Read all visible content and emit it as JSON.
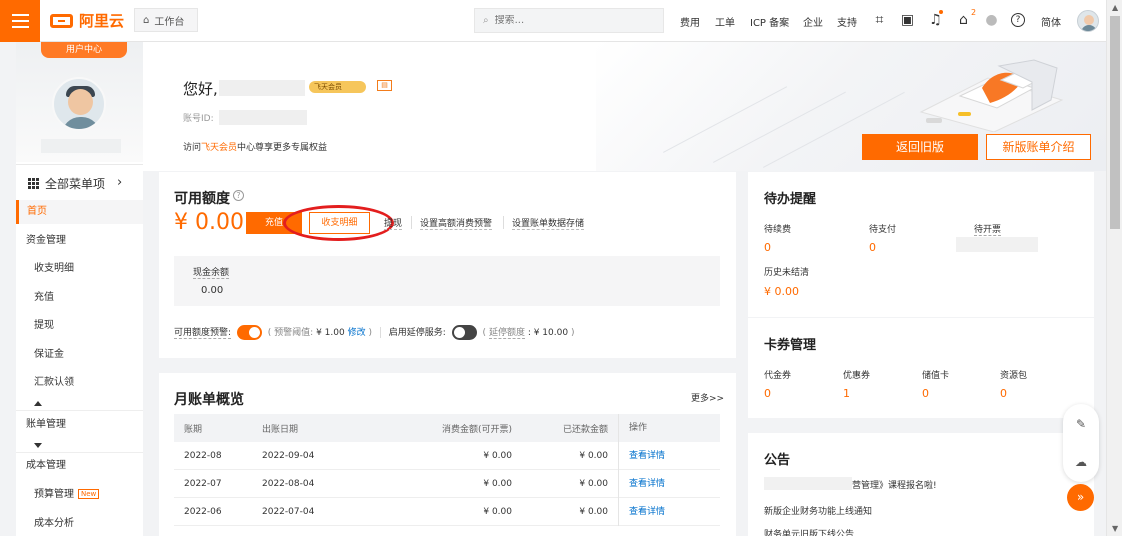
{
  "app": {
    "brand": "阿里云",
    "workbench": "工作台",
    "search_placeholder": "搜索...",
    "nav": [
      "费用",
      "工单",
      "ICP 备案",
      "企业",
      "支持",
      "简体"
    ],
    "notification_count": "2",
    "accent_color": "#ff6a00"
  },
  "sidebar": {
    "user_center": "用户中心",
    "all_menu": "全部菜单项",
    "items": [
      {
        "label": "首页"
      },
      {
        "label": "资金管理"
      },
      {
        "label": "收支明细"
      },
      {
        "label": "充值"
      },
      {
        "label": "提现"
      },
      {
        "label": "保证金"
      },
      {
        "label": "汇款认领"
      },
      {
        "label": "账单管理"
      },
      {
        "label": "成本管理"
      },
      {
        "label": "预算管理",
        "badge": "New"
      },
      {
        "label": "成本分析"
      }
    ]
  },
  "hero": {
    "greeting": "您好,",
    "vip": "飞天会员",
    "account_label": "账号ID:",
    "vip_prefix": "访问",
    "vip_link": "飞天会员",
    "vip_suffix": "中心尊享更多专属权益",
    "old_button": "返回旧版",
    "new_button": "新版账单介绍"
  },
  "credit": {
    "title": "可用额度",
    "help": "?",
    "amount": "¥ 0.00",
    "recharge": "充值",
    "details": "收支明细",
    "withdraw": "提现",
    "high_spend": "设置高额消费预警",
    "bill_storage": "设置账单数据存储",
    "cash_label": "现金余额",
    "cash_value": "0.00",
    "alert_label": "可用额度预警:",
    "alert_prefix": "( 预警阈值:",
    "alert_value": "¥ 1.00",
    "modify": "修改",
    "alert_suffix": ")",
    "service_label": "启用延停服务:",
    "service_prefix": "(",
    "service_quota_label": "延停额度",
    "service_value": ": ¥ 10.00",
    "service_suffix": ")"
  },
  "todo": {
    "title": "待办提醒",
    "renewal": {
      "label": "待续费",
      "value": "0"
    },
    "payment": {
      "label": "待支付",
      "value": "0"
    },
    "invoice": {
      "label": "待开票"
    },
    "history": {
      "label": "历史未结清",
      "value": "¥ 0.00"
    }
  },
  "cards": {
    "title": "卡券管理",
    "items": [
      {
        "label": "代金券",
        "value": "0"
      },
      {
        "label": "优惠券",
        "value": "1"
      },
      {
        "label": "储值卡",
        "value": "0"
      },
      {
        "label": "资源包",
        "value": "0"
      }
    ]
  },
  "monthly": {
    "title": "月账单概览",
    "more": "更多>>",
    "columns": [
      "账期",
      "出账日期",
      "消费金额(可开票)",
      "已还款金额",
      "操作"
    ],
    "rows": [
      [
        "2022-08",
        "2022-09-04",
        "¥ 0.00",
        "¥ 0.00",
        "查看详情"
      ],
      [
        "2022-07",
        "2022-08-04",
        "¥ 0.00",
        "¥ 0.00",
        "查看详情"
      ],
      [
        "2022-06",
        "2022-07-04",
        "¥ 0.00",
        "¥ 0.00",
        "查看详情"
      ]
    ]
  },
  "notice": {
    "title": "公告",
    "items": [
      "营管理》课程报名啦!",
      "新版企业财务功能上线通知",
      "财务单元旧版下线公告"
    ]
  }
}
